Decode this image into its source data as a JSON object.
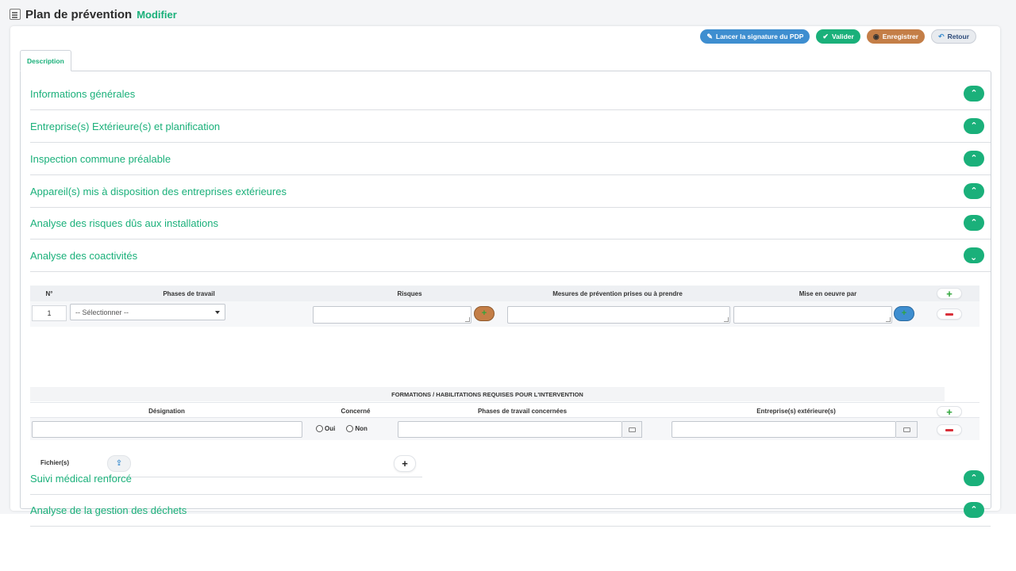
{
  "page": {
    "title": "Plan de prévention",
    "mode": "Modifier"
  },
  "toolbar": {
    "sign_label": "Lancer la signature du PDP",
    "validate_label": "Valider",
    "save_label": "Enregistrer",
    "back_label": "Retour"
  },
  "tabs": [
    {
      "label": "Description",
      "active": true
    }
  ],
  "sections": [
    {
      "label": "Informations générales",
      "expanded": false
    },
    {
      "label": "Entreprise(s) Extérieure(s) et planification",
      "expanded": false
    },
    {
      "label": "Inspection commune préalable",
      "expanded": false
    },
    {
      "label": "Appareil(s) mis à disposition des entreprises extérieures",
      "expanded": false
    },
    {
      "label": "Analyse des risques dûs aux installations",
      "expanded": false
    },
    {
      "label": "Analyse des coactivités",
      "expanded": true
    },
    {
      "label": "Suivi médical renforcé",
      "expanded": false
    },
    {
      "label": "Analyse de la gestion des déchets",
      "expanded": false
    }
  ],
  "coactivity_table": {
    "columns": [
      "N°",
      "Phases de travail",
      "Risques",
      "Mesures de prévention prises ou à prendre",
      "Mise en oeuvre par"
    ],
    "rows": [
      {
        "number": "1",
        "phase_select": "-- Sélectionner --",
        "risks": "",
        "measures": "",
        "implemented_by": ""
      }
    ]
  },
  "training_table": {
    "title": "FORMATIONS / HABILITATIONS REQUISES POUR L'INTERVENTION",
    "columns": [
      "Désignation",
      "Concerné",
      "Phases de travail concernées",
      "Entreprise(s) extérieure(s)"
    ],
    "radio_options": [
      "Oui",
      "Non"
    ],
    "rows": [
      {
        "designation": "",
        "concerned": null,
        "phases": "",
        "companies": ""
      }
    ]
  },
  "files": {
    "label": "Fichier(s)"
  },
  "colors": {
    "accent": "#1ab07a",
    "blue": "#3e8ed0",
    "brown": "#c47e47",
    "danger": "#d9303a"
  },
  "icons": {
    "section_collapsed": "chevron-up-icon",
    "section_expanded": "chevron-down-icon"
  }
}
